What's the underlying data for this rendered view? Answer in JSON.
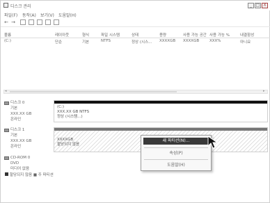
{
  "window": {
    "title": "디스크 관리",
    "controls": [
      "_",
      "□",
      "X"
    ]
  },
  "menubar": [
    "파일(F)",
    "동작(A)",
    "보기(V)",
    "도움말(H)"
  ],
  "toolbar": {
    "back_glyph": "←",
    "forward_glyph": "→",
    "icons": [
      "folder-icon",
      "properties-icon",
      "help-icon",
      "view-icon",
      "settings-icon"
    ]
  },
  "volume_list": {
    "headers": [
      "볼륨",
      "레이아웃",
      "형식",
      "파일 시스템",
      "상태",
      "용량",
      "사용 가능 공간",
      "사용 가능 %",
      "내결함성"
    ],
    "rows": [
      [
        "(C:)",
        "단순",
        "기본",
        "NTFS",
        "정상 (시스...",
        "XXXXGB",
        "XXXXGB",
        "XXX%",
        "아니요"
      ]
    ]
  },
  "disks": [
    {
      "name": "디스크 0",
      "type": "기본",
      "size": "XXX.XX GB",
      "state": "온라인",
      "volume": {
        "line1": "(C:)",
        "line2": "XXX.XX GB NTFS",
        "line3": "정상 (시스템...)"
      }
    },
    {
      "name": "디스크 1",
      "type": "기본",
      "size": "XXX.XX GB",
      "state": "온라인",
      "volume": {
        "line1": "XXXXGB",
        "line2": "할당되지 않음"
      }
    },
    {
      "name": "CD-ROM 0",
      "type": "DVD",
      "state": "미디어 없음"
    }
  ],
  "status": "할당되지 않음 ■ 주 파티션",
  "context_menu": {
    "items": [
      "새 파티션(N)...",
      "속성(P)",
      "도움말(H)"
    ],
    "highlighted_index": 0
  },
  "colors": {
    "primary_stripe": "#111111",
    "highlight": "#3a3a3a"
  }
}
